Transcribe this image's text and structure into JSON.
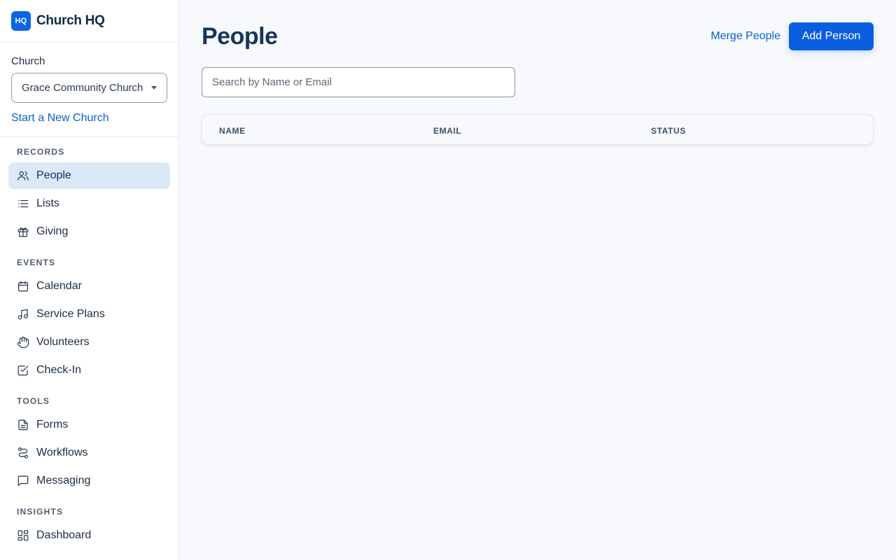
{
  "brand": {
    "logo_text": "HQ",
    "name": "Church HQ",
    "accent": "#0a66e4"
  },
  "church": {
    "label": "Church",
    "selected": "Grace Community Church (",
    "new_link": "Start a New Church"
  },
  "nav": {
    "sections": {
      "records": "RECORDS",
      "events": "EVENTS",
      "tools": "TOOLS",
      "insights": "INSIGHTS"
    },
    "items": {
      "people": {
        "label": "People",
        "icon": "users-icon",
        "active": true
      },
      "lists": {
        "label": "Lists",
        "icon": "list-icon"
      },
      "giving": {
        "label": "Giving",
        "icon": "gift-icon"
      },
      "calendar": {
        "label": "Calendar",
        "icon": "calendar-icon"
      },
      "service_plans": {
        "label": "Service Plans",
        "icon": "music-icon"
      },
      "volunteers": {
        "label": "Volunteers",
        "icon": "hand-icon"
      },
      "check_in": {
        "label": "Check-In",
        "icon": "check-square-icon"
      },
      "forms": {
        "label": "Forms",
        "icon": "file-icon"
      },
      "workflows": {
        "label": "Workflows",
        "icon": "route-icon"
      },
      "messaging": {
        "label": "Messaging",
        "icon": "message-icon"
      },
      "dashboard": {
        "label": "Dashboard",
        "icon": "dashboard-icon"
      }
    }
  },
  "page": {
    "title": "People",
    "merge_label": "Merge People",
    "add_label": "Add Person",
    "search_placeholder": "Search by Name or Email",
    "table": {
      "columns": [
        "NAME",
        "EMAIL",
        "STATUS"
      ],
      "rows": []
    }
  },
  "colors": {
    "primary": "#0a5fe0",
    "active_bg": "#dbe8f8",
    "link": "#0a62c9"
  }
}
